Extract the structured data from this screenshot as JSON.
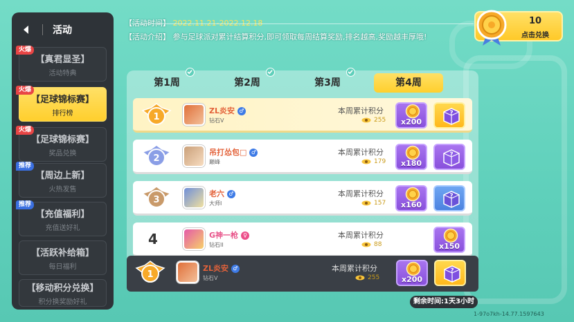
{
  "sidebar": {
    "title": "活动",
    "items": [
      {
        "badge": "火爆",
        "badge_type": "hot",
        "label": "【真君显圣】",
        "sub": "活动特典"
      },
      {
        "badge": "火爆",
        "badge_type": "hot",
        "label": "【足球锦标赛】",
        "sub": "排行榜",
        "active": true
      },
      {
        "badge": "火爆",
        "badge_type": "hot",
        "label": "【足球锦标赛】",
        "sub": "奖品兑换"
      },
      {
        "badge": "推荐",
        "badge_type": "rec",
        "label": "【周边上新】",
        "sub": "火热发售"
      },
      {
        "badge": "推荐",
        "badge_type": "rec",
        "label": "【充值福利】",
        "sub": "充值送好礼"
      },
      {
        "badge": "",
        "label": "【活跃补给箱】",
        "sub": "每日福利"
      },
      {
        "badge": "",
        "label": "【移动积分兑换】",
        "sub": "积分换奖励好礼"
      }
    ]
  },
  "info": {
    "time_label": "【活动时间】",
    "time_value": "2022.11.21-2022.12.18",
    "intro_label": "【活动介绍】",
    "intro_text": "参与足球派对累计结算积分,即可领取每周结算奖励,排名越高,奖励越丰厚哦!"
  },
  "exchange": {
    "count": "10",
    "label": "点击兑换"
  },
  "tabs": [
    {
      "label": "第1周",
      "checked": true
    },
    {
      "label": "第2周",
      "checked": true
    },
    {
      "label": "第3周",
      "checked": true
    },
    {
      "label": "第4周",
      "checked": false,
      "active": true
    }
  ],
  "rows": [
    {
      "rank": "1",
      "name": "ZL炎安",
      "gender": "male",
      "tier": "钻石V",
      "score_label": "本周累计积分",
      "score": "255",
      "coins": "x200",
      "box": "gold"
    },
    {
      "rank": "2",
      "name": "吊打怂包□",
      "gender": "male",
      "tier": "巅峰",
      "score_label": "本周累计积分",
      "score": "179",
      "coins": "x180",
      "box": "purple"
    },
    {
      "rank": "3",
      "name": "老六",
      "gender": "male",
      "tier": "大师I",
      "score_label": "本周累计积分",
      "score": "157",
      "coins": "x160",
      "box": "blue"
    },
    {
      "rank": "4",
      "name": "G神一枪",
      "gender": "female",
      "tier": "钻石II",
      "score_label": "本周累计积分",
      "score": "88",
      "coins": "x150",
      "box": ""
    }
  ],
  "self_row": {
    "rank": "1",
    "name": "ZL炎安",
    "gender": "male",
    "tier": "钻石V",
    "score_label": "本周累计积分",
    "score": "255",
    "coins": "x200",
    "box": "gold"
  },
  "remaining": "剩余时间:1天3小时",
  "version": "1-97o7kh-14.77.1597643",
  "colors": {
    "accent": "#ffcf2d",
    "bg": "#5fd0bb",
    "panel_dark": "#2e3338",
    "reward_purple": "#8950dc"
  }
}
